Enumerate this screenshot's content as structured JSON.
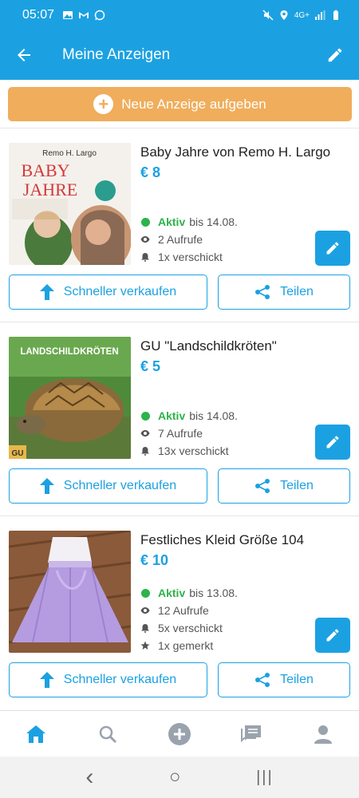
{
  "status_bar": {
    "time": "05:07",
    "network": "4G+"
  },
  "app_bar": {
    "title": "Meine Anzeigen",
    "back_icon": "arrow-left-icon",
    "edit_icon": "pencil-icon"
  },
  "new_ad_button": {
    "label": "Neue Anzeige aufgeben",
    "plus_symbol": "+"
  },
  "colors": {
    "primary": "#1ba1e2",
    "accent_orange": "#f0ad5c",
    "active_green": "#2cb34a"
  },
  "listings": [
    {
      "title": "Baby Jahre von Remo H. Largo",
      "price": "€ 8",
      "status": "Aktiv",
      "until": "bis 14.08.",
      "views": "2 Aufrufe",
      "sent": "1x verschickt",
      "book_author": "Remo H. Largo",
      "book_title_1": "BABY",
      "book_title_2": "JAHRE"
    },
    {
      "title": "GU \"Landschildkröten\"",
      "price": "€ 5",
      "status": "Aktiv",
      "until": "bis 14.08.",
      "views": "7 Aufrufe",
      "sent": "13x verschickt",
      "book_title": "LANDSCHILDKRÖTEN",
      "book_brand": "GU"
    },
    {
      "title": "Festliches Kleid Größe 104",
      "price": "€ 10",
      "status": "Aktiv",
      "until": "bis 13.08.",
      "views": "12 Aufrufe",
      "sent": "5x verschickt",
      "saved": "1x gemerkt"
    }
  ],
  "actions": {
    "sell_faster": "Schneller verkaufen",
    "share": "Teilen"
  },
  "bottom_nav": [
    "home-icon",
    "search-icon",
    "add-circle-icon",
    "messages-icon",
    "profile-icon"
  ],
  "system_nav": {
    "back": "‹",
    "home": "○",
    "recents": "|||"
  }
}
